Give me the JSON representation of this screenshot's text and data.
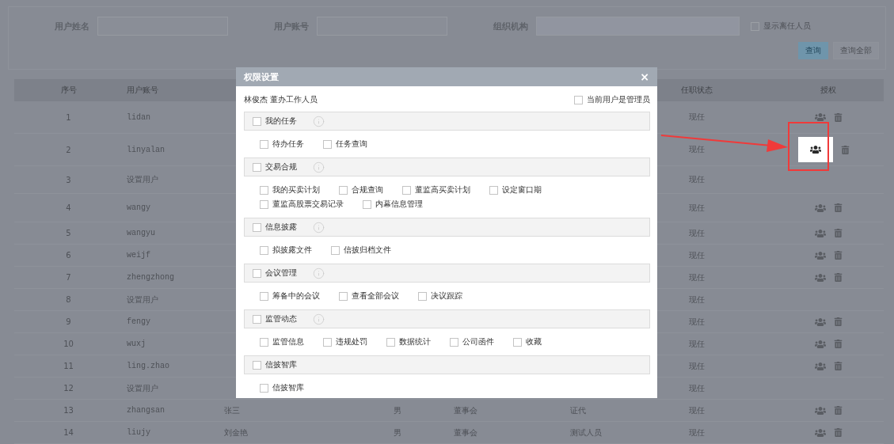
{
  "filters": {
    "fields": [
      {
        "label": "用户姓名",
        "kind": "text"
      },
      {
        "label": "用户账号",
        "kind": "text"
      },
      {
        "label": "组织机构",
        "kind": "select"
      }
    ],
    "show_former": {
      "label": "显示离任人员",
      "checked": false
    },
    "buttons": [
      {
        "label": "查询",
        "kind": "primary"
      },
      {
        "label": "查询全部",
        "kind": "default"
      }
    ]
  },
  "table": {
    "header": {
      "index": "序号",
      "account": "用户账号",
      "status": "任职状态",
      "auth": "授权"
    },
    "rows": [
      {
        "index": "1",
        "account": "lidan",
        "status": "现任",
        "actions": true,
        "highlighted": false
      },
      {
        "index": "2",
        "account": "linyalan",
        "status": "现任",
        "actions": true,
        "highlighted": true
      },
      {
        "index": "3",
        "account": "设置用户",
        "status": "现任",
        "actions": false,
        "highlighted": false
      },
      {
        "index": "4",
        "account": "wangy",
        "status": "现任",
        "actions": true,
        "highlighted": false
      },
      {
        "index": "5",
        "account": "wangyu",
        "status": "现任",
        "actions": true,
        "highlighted": false
      },
      {
        "index": "6",
        "account": "weijf",
        "status": "现任",
        "actions": true,
        "highlighted": false
      },
      {
        "index": "7",
        "account": "zhengzhong",
        "status": "现任",
        "actions": true,
        "highlighted": false
      },
      {
        "index": "8",
        "account": "设置用户",
        "status": "现任",
        "actions": false,
        "highlighted": false
      },
      {
        "index": "9",
        "account": "fengy",
        "status": "现任",
        "actions": true,
        "highlighted": false
      },
      {
        "index": "10",
        "account": "wuxj",
        "status": "现任",
        "actions": true,
        "highlighted": false
      },
      {
        "index": "11",
        "account": "ling.zhao",
        "status": "现任",
        "actions": true,
        "highlighted": false
      },
      {
        "index": "12",
        "account": "设置用户",
        "status": "现任",
        "actions": false,
        "highlighted": false
      },
      {
        "index": "13",
        "account": "zhangsan",
        "name": "张三",
        "gender": "男",
        "org": "董事会",
        "role": "证代",
        "status": "现任",
        "actions": true,
        "highlighted": false
      },
      {
        "index": "14",
        "account": "liujy",
        "name": "刘金艳",
        "gender": "男",
        "org": "董事会",
        "role": "测试人员",
        "status": "现任",
        "actions": true,
        "highlighted": false
      }
    ]
  },
  "dialog": {
    "title": "权限设置",
    "close": "×",
    "user": "林俊杰 董办工作人员",
    "admin": {
      "label": "当前用户是管理员",
      "checked": false
    },
    "groups": [
      {
        "label": "我的任务",
        "checked": false,
        "info": true,
        "children": [
          {
            "label": "待办任务",
            "checked": false
          },
          {
            "label": "任务查询",
            "checked": false
          }
        ]
      },
      {
        "label": "交易合规",
        "checked": false,
        "info": true,
        "children": [
          {
            "label": "我的买卖计划",
            "checked": false
          },
          {
            "label": "合规查询",
            "checked": false
          },
          {
            "label": "董监高买卖计划",
            "checked": false
          },
          {
            "label": "设定窗口期",
            "checked": false
          },
          {
            "label": "董监高股票交易记录",
            "checked": false
          },
          {
            "label": "内幕信息管理",
            "checked": false
          }
        ]
      },
      {
        "label": "信息披露",
        "checked": false,
        "info": true,
        "children": [
          {
            "label": "拟披露文件",
            "checked": false
          },
          {
            "label": "信披归档文件",
            "checked": false
          }
        ]
      },
      {
        "label": "会议管理",
        "checked": false,
        "info": true,
        "children": [
          {
            "label": "筹备中的会议",
            "checked": false
          },
          {
            "label": "查看全部会议",
            "checked": false
          },
          {
            "label": "决议跟踪",
            "checked": false
          }
        ]
      },
      {
        "label": "监管动态",
        "checked": false,
        "info": true,
        "children": [
          {
            "label": "监管信息",
            "checked": false
          },
          {
            "label": "违规处罚",
            "checked": false
          },
          {
            "label": "数据统计",
            "checked": false
          },
          {
            "label": "公司函件",
            "checked": false
          },
          {
            "label": "收藏",
            "checked": false
          }
        ]
      },
      {
        "label": "信披智库",
        "checked": false,
        "info": false,
        "children": [
          {
            "label": "信披智库",
            "checked": false
          }
        ]
      }
    ]
  }
}
